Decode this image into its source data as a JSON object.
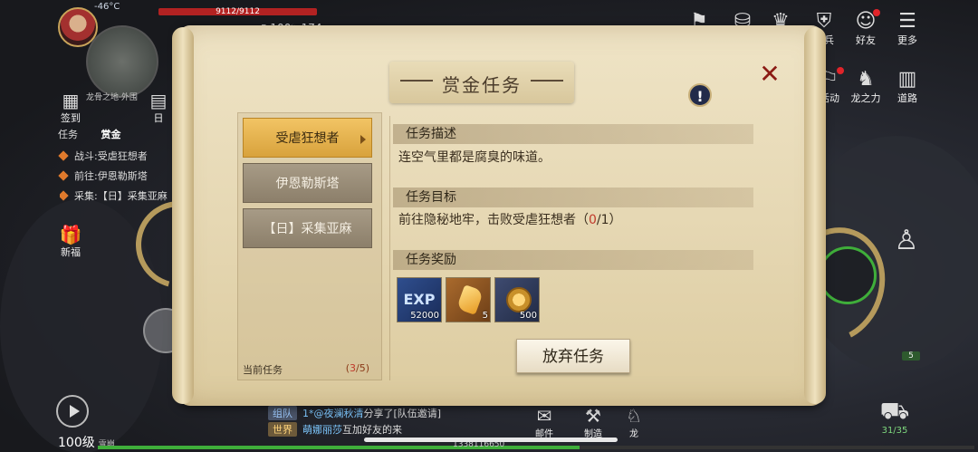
{
  "hud": {
    "temperature": "-46°C",
    "hp_text": "9112/9112",
    "hp_fraction": 1.0,
    "res_a": "100",
    "res_b": "174",
    "map_name": "龙骨之地·外围",
    "sign_in": "签到",
    "sign_in_right": "日",
    "new_event": "新福",
    "quest_tabs": [
      "任务",
      "赏金"
    ],
    "tracked": [
      "战斗:受虐狂想者",
      "前往:伊恩勒斯塔",
      "采集:【日】采集亚麻"
    ]
  },
  "top_menu": [
    {
      "label": "组队",
      "icon": "team-icon"
    },
    {
      "label": "商店",
      "icon": "shop-icon"
    },
    {
      "label": "生存",
      "icon": "survival-icon"
    },
    {
      "label": "佣兵",
      "icon": "mercenary-icon"
    },
    {
      "label": "好友",
      "icon": "friends-icon"
    },
    {
      "label": "更多",
      "icon": "more-icon"
    }
  ],
  "side_menu": [
    {
      "label": "活动",
      "icon": "event-icon"
    },
    {
      "label": "龙之力",
      "icon": "dragon-icon"
    },
    {
      "label": "道路",
      "icon": "road-icon"
    }
  ],
  "dialog": {
    "title": "赏金任务",
    "close": "✕",
    "info": "!",
    "quests": [
      "受虐狂想者",
      "伊恩勒斯塔",
      "【日】采集亚麻"
    ],
    "selected_index": 0,
    "current_label": "当前任务",
    "current_count_open": "(",
    "current_count_value": "3",
    "current_count_rest": "/5)",
    "desc_title": "任务描述",
    "desc_text": "连空气里都是腐臭的味道。",
    "goal_title": "任务目标",
    "goal_text_a": "前往隐秘地牢，击败受虐狂想者（",
    "goal_progress": "0",
    "goal_text_b": "/1）",
    "reward_title": "任务奖励",
    "rewards": [
      {
        "label": "EXP",
        "count": "52000",
        "icon": "exp-icon"
      },
      {
        "label": "",
        "count": "5",
        "icon": "gem-icon"
      },
      {
        "label": "",
        "count": "500",
        "icon": "coin-icon"
      }
    ],
    "abandon": "放弃任务"
  },
  "chat": [
    {
      "channel": "组队",
      "name": "1*@夜澜秋清",
      "text": "分享了[队伍邀请]"
    },
    {
      "channel": "世界",
      "name": "萌娜丽莎",
      "text": "互加好友的来"
    }
  ],
  "bottom": {
    "level": "100级",
    "player": "雪崩",
    "exp_number": "1338116650",
    "bag": "31/35",
    "mail": "邮件",
    "craft": "制造",
    "dragon": "龙",
    "potion_count": "5"
  },
  "colors": {
    "accent_gold": "#e0b04a",
    "parchment": "#e6d8b4",
    "progress_red": "#c0392b",
    "skill_green": "#3fae3a"
  }
}
